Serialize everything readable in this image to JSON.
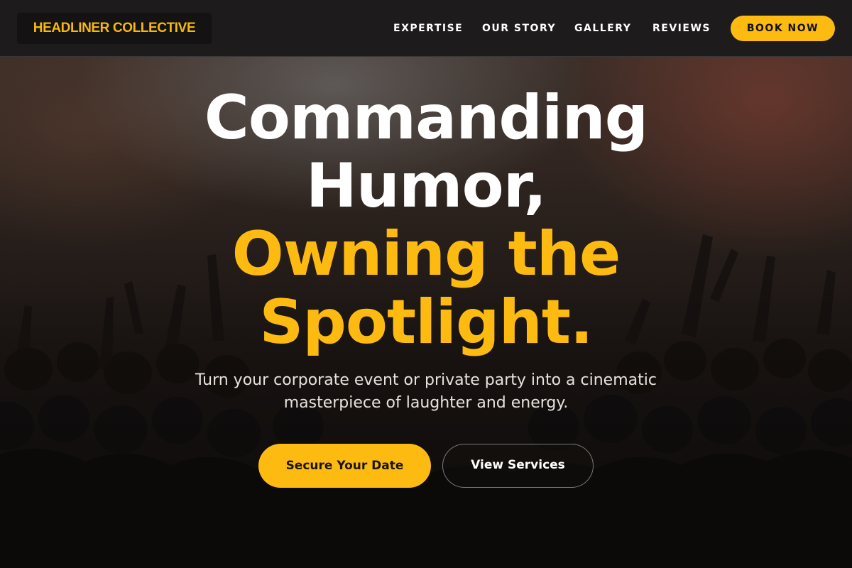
{
  "navbar": {
    "brand": "HEADLINER COLLECTIVE",
    "links": [
      "EXPERTISE",
      "OUR STORY",
      "GALLERY",
      "REVIEWS"
    ],
    "cta": "BOOK NOW"
  },
  "hero": {
    "headline_white": [
      "Commanding",
      "Humor,"
    ],
    "headline_gold": [
      "Owning the",
      "Spotlight."
    ],
    "subtitle": "Turn your corporate event or private party into a cinematic masterpiece of laughter and energy.",
    "primary_button": "Secure Your Date",
    "secondary_button": "View Services"
  },
  "colors": {
    "accent": "#fdbb12",
    "navbar_bg": "#1d1b1b",
    "text_primary": "#ffffff"
  }
}
